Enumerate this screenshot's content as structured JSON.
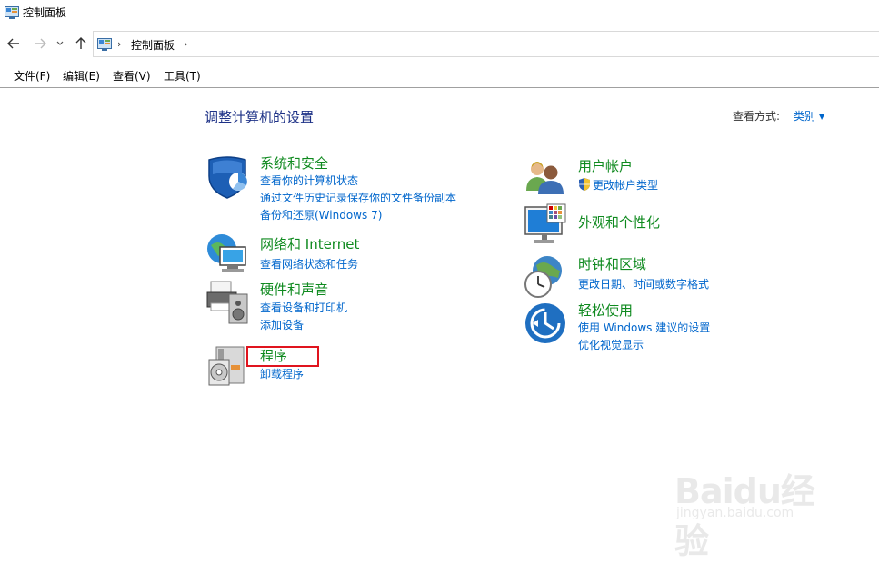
{
  "window": {
    "title": "控制面板"
  },
  "address": {
    "crumb": "控制面板",
    "separator": "›"
  },
  "menubar": {
    "items": [
      {
        "label": "文件(F)"
      },
      {
        "label": "编辑(E)"
      },
      {
        "label": "查看(V)"
      },
      {
        "label": "工具(T)"
      }
    ]
  },
  "main": {
    "title": "调整计算机的设置",
    "view_by_label": "查看方式:",
    "view_by_value": "类别"
  },
  "categories": {
    "system": {
      "title": "系统和安全",
      "links": [
        "查看你的计算机状态",
        "通过文件历史记录保存你的文件备份副本",
        "备份和还原(Windows 7)"
      ],
      "icon": "shield-icon"
    },
    "network": {
      "title": "网络和 Internet",
      "links": [
        "查看网络状态和任务"
      ],
      "icon": "network-globe-icon"
    },
    "hardware": {
      "title": "硬件和声音",
      "links": [
        "查看设备和打印机",
        "添加设备"
      ],
      "icon": "printer-speaker-icon"
    },
    "programs": {
      "title": "程序",
      "links": [
        "卸载程序"
      ],
      "icon": "programs-disc-icon"
    },
    "users": {
      "title": "用户帐户",
      "links": [
        "更改帐户类型"
      ],
      "icon": "users-icon"
    },
    "appearance": {
      "title": "外观和个性化",
      "links": [],
      "icon": "monitor-palette-icon"
    },
    "clock": {
      "title": "时钟和区域",
      "links": [
        "更改日期、时间或数字格式"
      ],
      "icon": "globe-clock-icon"
    },
    "ease": {
      "title": "轻松使用",
      "links": [
        "使用 Windows 建议的设置",
        "优化视觉显示"
      ],
      "icon": "ease-of-access-icon"
    }
  },
  "watermark": {
    "text": "Baidu经验",
    "sub": "jingyan.baidu.com"
  },
  "colors": {
    "category_title": "#0f8a1f",
    "link": "#0066cc",
    "page_title": "#1e3287",
    "highlight_box": "#e0141e"
  }
}
